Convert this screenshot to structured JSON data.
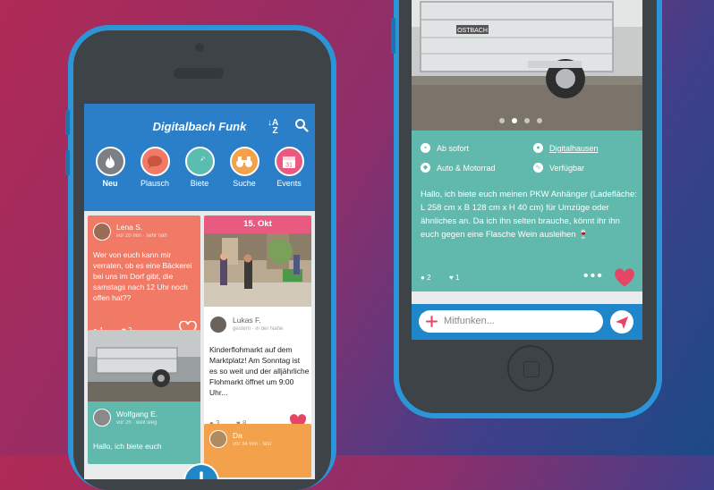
{
  "left_app": {
    "title": "Digitalbach Funk",
    "categories": [
      {
        "label": "Neu",
        "color": "#7c8085",
        "icon": "flame-icon"
      },
      {
        "label": "Plausch",
        "color": "#f07a66",
        "icon": "speech-bubble-icon"
      },
      {
        "label": "Biete",
        "color": "#5bbdb1",
        "icon": "tag-icon"
      },
      {
        "label": "Suche",
        "color": "#f3a14a",
        "icon": "binoculars-icon"
      },
      {
        "label": "Events",
        "color": "#e85a7f",
        "icon": "calendar-icon",
        "day": "31"
      }
    ],
    "post1": {
      "name": "Lena S.",
      "meta": "vor 20 min · sehr nah",
      "text": "Wer von euch kann mir verraten, ob es eine Bäckerei bei uns im Dorf gibt, die samstags nach 12 Uhr noch offen hat??",
      "comments": "1",
      "likes": "2",
      "color": "#f07a66"
    },
    "event": {
      "date": "15. Okt",
      "name": "Lukas F.",
      "meta": "gestern · in der Nähe",
      "text": "Kinderflohmarkt auf dem Marktplatz! Am Sonntag ist es so weit und der alljährliche Flohmarkt öffnet um 9:00 Uhr...",
      "comments": "3",
      "likes": "8"
    },
    "post3": {
      "name": "Wolfgang E.",
      "meta": "vor 2h · weit weg",
      "text": "Hallo, ich biete euch"
    },
    "post4": {
      "name": "Da",
      "meta": "vor 34 min · fast"
    }
  },
  "right_app": {
    "info": {
      "availability": "Ab sofort",
      "location": "Digitalhausen",
      "category": "Auto & Motorrad",
      "status": "Verfügbar"
    },
    "description": "Hallo, ich biete euch meinen PKW Anhänger (Ladefläche: L 258 cm x B 128 cm x H 40 cm) für Umzüge oder ähnliches an. Da ich ihn selten brauche, könnt ihr ihn euch gegen eine Flasche Wein ausleihen 🍷",
    "comments": "2",
    "likes": "1",
    "input_placeholder": "Mitfunken...",
    "trailer_brand": "OSTBACH"
  }
}
